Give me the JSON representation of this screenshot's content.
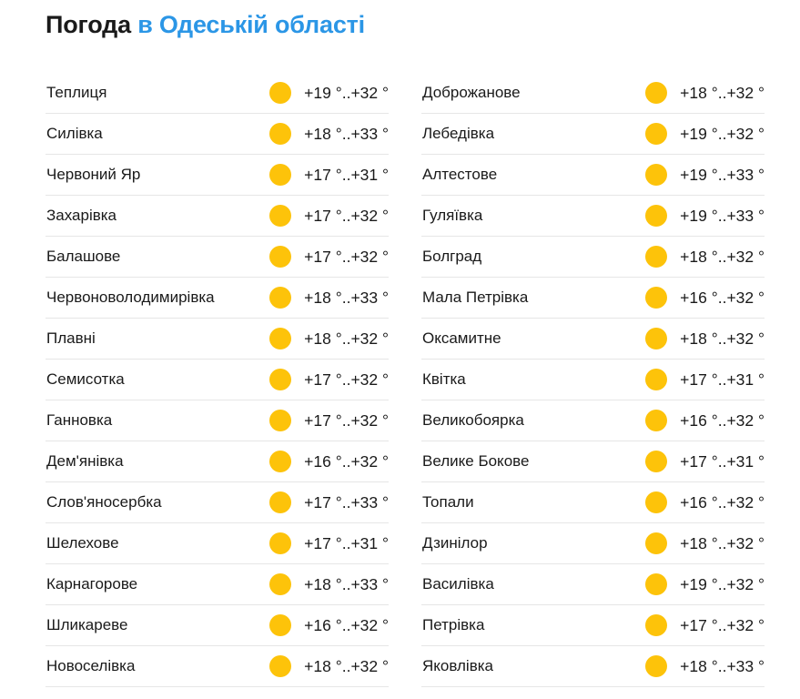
{
  "header": {
    "title_main": "Погода",
    "title_region": "в Одеській області"
  },
  "colors": {
    "accent": "#2b96e6",
    "sun": "#fdc30a",
    "divider": "#e6e6e6"
  },
  "left_column": [
    {
      "name": "Теплиця",
      "icon": "sun-icon",
      "temp": "+19 °..+32 °"
    },
    {
      "name": "Силівка",
      "icon": "sun-icon",
      "temp": "+18 °..+33 °"
    },
    {
      "name": "Червоний Яр",
      "icon": "sun-icon",
      "temp": "+17 °..+31 °"
    },
    {
      "name": "Захарівка",
      "icon": "sun-icon",
      "temp": "+17 °..+32 °"
    },
    {
      "name": "Балашове",
      "icon": "sun-icon",
      "temp": "+17 °..+32 °"
    },
    {
      "name": "Червоноволодимирівка",
      "icon": "sun-icon",
      "temp": "+18 °..+33 °"
    },
    {
      "name": "Плавні",
      "icon": "sun-icon",
      "temp": "+18 °..+32 °"
    },
    {
      "name": "Семисотка",
      "icon": "sun-icon",
      "temp": "+17 °..+32 °"
    },
    {
      "name": "Ганновка",
      "icon": "sun-icon",
      "temp": "+17 °..+32 °"
    },
    {
      "name": "Дем'янівка",
      "icon": "sun-icon",
      "temp": "+16 °..+32 °"
    },
    {
      "name": "Слов'яносербка",
      "icon": "sun-icon",
      "temp": "+17 °..+33 °"
    },
    {
      "name": "Шелехове",
      "icon": "sun-icon",
      "temp": "+17 °..+31 °"
    },
    {
      "name": "Карнагорове",
      "icon": "sun-icon",
      "temp": "+18 °..+33 °"
    },
    {
      "name": "Шликареве",
      "icon": "sun-icon",
      "temp": "+16 °..+32 °"
    },
    {
      "name": "Новоселівка",
      "icon": "sun-icon",
      "temp": "+18 °..+32 °"
    }
  ],
  "right_column": [
    {
      "name": "Доброжанове",
      "icon": "sun-icon",
      "temp": "+18 °..+32 °"
    },
    {
      "name": "Лебедівка",
      "icon": "sun-icon",
      "temp": "+19 °..+32 °"
    },
    {
      "name": "Алтестове",
      "icon": "sun-icon",
      "temp": "+19 °..+33 °"
    },
    {
      "name": "Гуляївка",
      "icon": "sun-icon",
      "temp": "+19 °..+33 °"
    },
    {
      "name": "Болград",
      "icon": "sun-icon",
      "temp": "+18 °..+32 °"
    },
    {
      "name": "Мала Петрівка",
      "icon": "sun-icon",
      "temp": "+16 °..+32 °"
    },
    {
      "name": "Оксамитне",
      "icon": "sun-icon",
      "temp": "+18 °..+32 °"
    },
    {
      "name": "Квітка",
      "icon": "sun-icon",
      "temp": "+17 °..+31 °"
    },
    {
      "name": "Великобоярка",
      "icon": "sun-icon",
      "temp": "+16 °..+32 °"
    },
    {
      "name": "Велике Бокове",
      "icon": "sun-icon",
      "temp": "+17 °..+31 °"
    },
    {
      "name": "Топали",
      "icon": "sun-icon",
      "temp": "+16 °..+32 °"
    },
    {
      "name": "Дзинілор",
      "icon": "sun-icon",
      "temp": "+18 °..+32 °"
    },
    {
      "name": "Василівка",
      "icon": "sun-icon",
      "temp": "+19 °..+32 °"
    },
    {
      "name": "Петрівка",
      "icon": "sun-icon",
      "temp": "+17 °..+32 °"
    },
    {
      "name": "Яковлівка",
      "icon": "sun-icon",
      "temp": "+18 °..+33 °"
    }
  ]
}
